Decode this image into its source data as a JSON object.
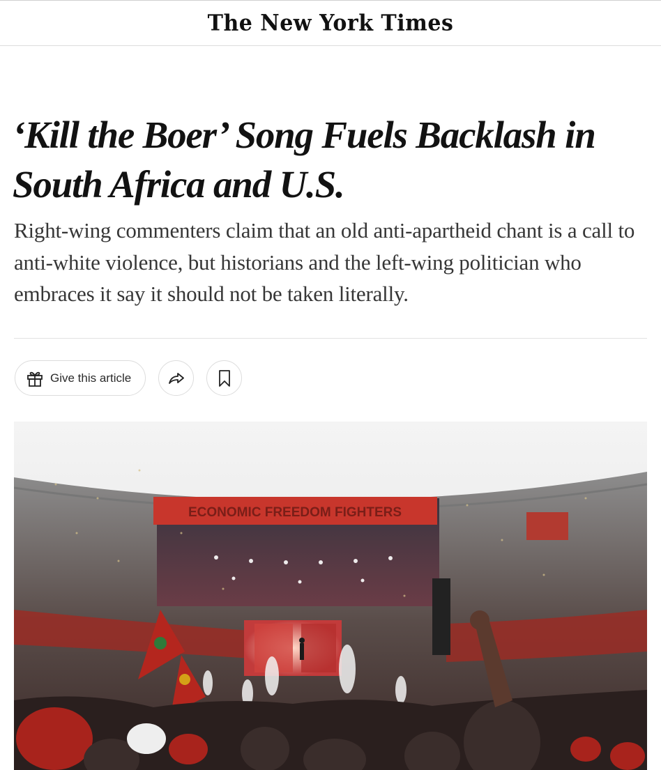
{
  "masthead": {
    "logo_text": "The New York Times"
  },
  "article": {
    "headline": "‘Kill the Boer’ Song Fuels Backlash in South Africa and U.S.",
    "summary": "Right-wing commenters claim that an old anti-apartheid chant is a call to anti-white violence, but historians and the left-wing politician who embraces it say it should not be taken literally."
  },
  "actions": {
    "gift_label": "Give this article",
    "share_icon": "share-arrow-icon",
    "save_icon": "bookmark-icon",
    "gift_icon": "gift-icon"
  },
  "photo": {
    "banner_text": "ECONOMIC FREEDOM FIGHTERS",
    "colors": {
      "banner": "#c8362c",
      "crowd_red": "#a8231c",
      "flag_green": "#2f7a3a",
      "flag_gold": "#d4a017"
    }
  }
}
